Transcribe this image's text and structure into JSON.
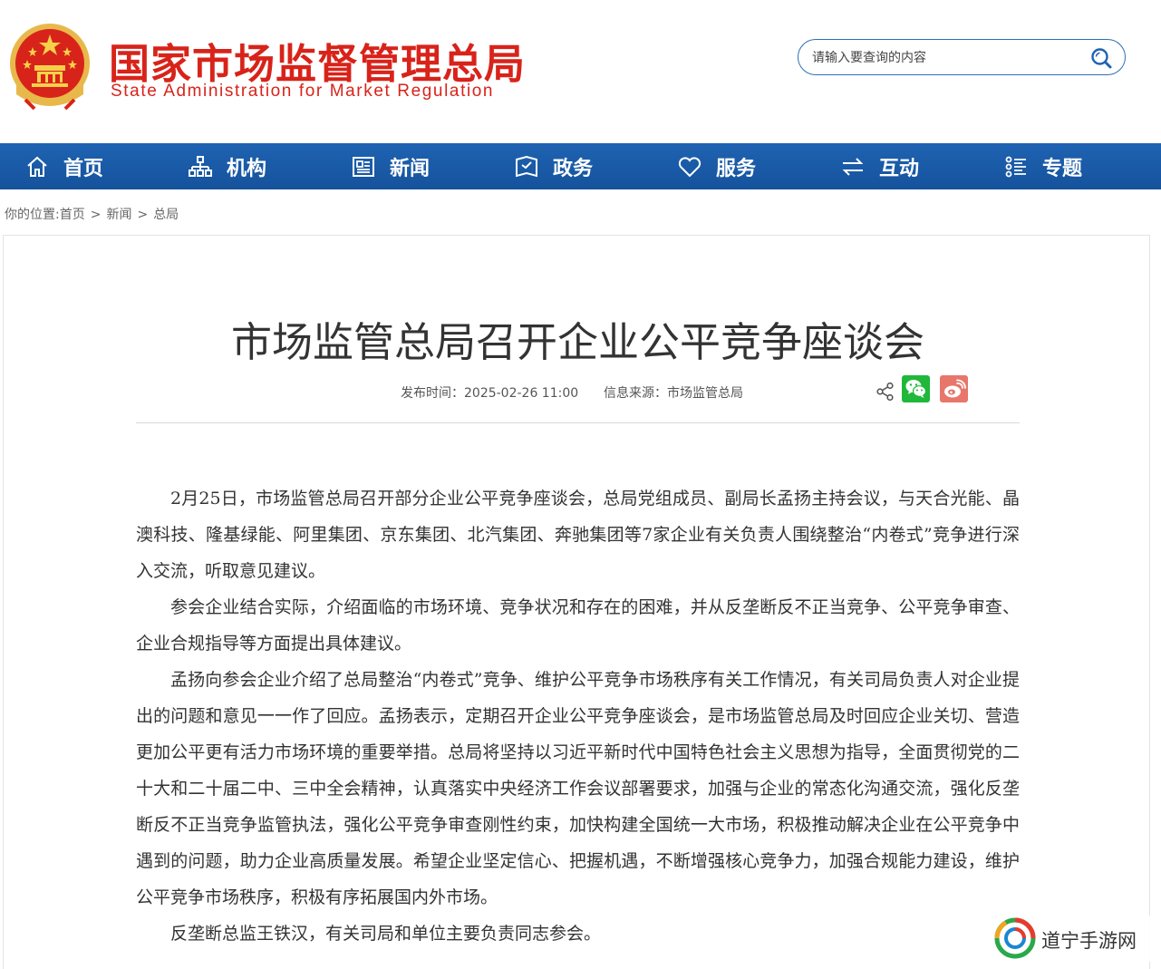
{
  "header": {
    "site_name_cn": "国家市场监督管理总局",
    "site_name_en": "State Administration for Market Regulation",
    "search_placeholder": "请输入要查询的内容"
  },
  "nav": {
    "items": [
      {
        "label": "首页",
        "icon": "home-icon"
      },
      {
        "label": "机构",
        "icon": "org-icon"
      },
      {
        "label": "新闻",
        "icon": "news-icon"
      },
      {
        "label": "政务",
        "icon": "gov-affairs-icon"
      },
      {
        "label": "服务",
        "icon": "heart-icon"
      },
      {
        "label": "互动",
        "icon": "exchange-icon"
      },
      {
        "label": "专题",
        "icon": "topic-list-icon"
      }
    ]
  },
  "breadcrumb": {
    "prefix": "你的位置:",
    "items": [
      "首页",
      "新闻",
      "总局"
    ],
    "separator": ">"
  },
  "article": {
    "title": "市场监管总局召开企业公平竞争座谈会",
    "publish_time": "发布时间：2025-02-26 11:00",
    "source": "信息来源：市场监管总局",
    "paragraphs": [
      "2月25日，市场监管总局召开部分企业公平竞争座谈会，总局党组成员、副局长孟扬主持会议，与天合光能、晶澳科技、隆基绿能、阿里集团、京东集团、北汽集团、奔驰集团等7家企业有关负责人围绕整治“内卷式”竞争进行深入交流，听取意见建议。",
      "参会企业结合实际，介绍面临的市场环境、竞争状况和存在的困难，并从反垄断反不正当竞争、公平竞争审查、企业合规指导等方面提出具体建议。",
      "孟扬向参会企业介绍了总局整治“内卷式”竞争、维护公平竞争市场秩序有关工作情况，有关司局负责人对企业提出的问题和意见一一作了回应。孟扬表示，定期召开企业公平竞争座谈会，是市场监管总局及时回应企业关切、营造更加公平更有活力市场环境的重要举措。总局将坚持以习近平新时代中国特色社会主义思想为指导，全面贯彻党的二十大和二十届二中、三中全会精神，认真落实中央经济工作会议部署要求，加强与企业的常态化沟通交流，强化反垄断反不正当竞争监管执法，强化公平竞争审查刚性约束，加快构建全国统一大市场，积极推动解决企业在公平竞争中遇到的问题，助力企业高质量发展。希望企业坚定信心、把握机遇，不断增强核心竞争力，加强合规能力建设，维护公平竞争市场秩序，积极有序拓展国内外市场。",
      "反垄断总监王铁汉，有关司局和单位主要负责同志参会。"
    ]
  },
  "share": {
    "icons": [
      "share-icon",
      "wechat-icon",
      "weibo-icon"
    ]
  },
  "watermark": {
    "text": "道宁手游网"
  },
  "colors": {
    "brand_red": "#d8231a",
    "nav_blue": "#1a5ba8",
    "wechat_green": "#1fb83a",
    "weibo_red": "#e8766b"
  }
}
